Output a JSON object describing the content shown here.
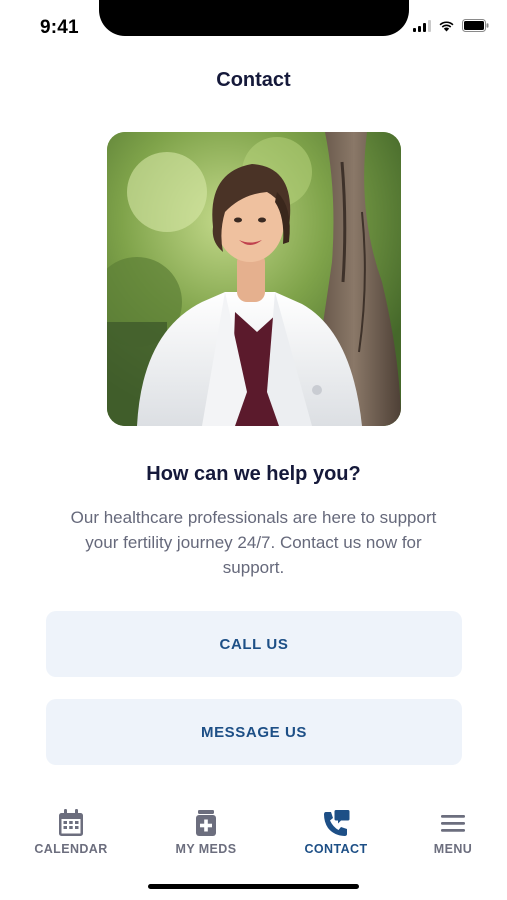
{
  "status_bar": {
    "time": "9:41"
  },
  "page": {
    "title": "Contact"
  },
  "hero": {
    "heading": "How can we help you?",
    "description": "Our healthcare professionals are here to support your fertility journey 24/7. Contact us now for support."
  },
  "actions": {
    "call_label": "CALL US",
    "message_label": "MESSAGE US"
  },
  "tabbar": {
    "items": [
      {
        "label": "CALENDAR",
        "icon": "calendar-icon",
        "active": false
      },
      {
        "label": "MY MEDS",
        "icon": "medicine-bottle-icon",
        "active": false
      },
      {
        "label": "CONTACT",
        "icon": "phone-chat-icon",
        "active": true
      },
      {
        "label": "MENU",
        "icon": "hamburger-menu-icon",
        "active": false
      }
    ]
  },
  "colors": {
    "title": "#15193a",
    "accent": "#1d4f86",
    "button_bg": "#eef3fa",
    "inactive_tab": "#6c6e7e"
  }
}
